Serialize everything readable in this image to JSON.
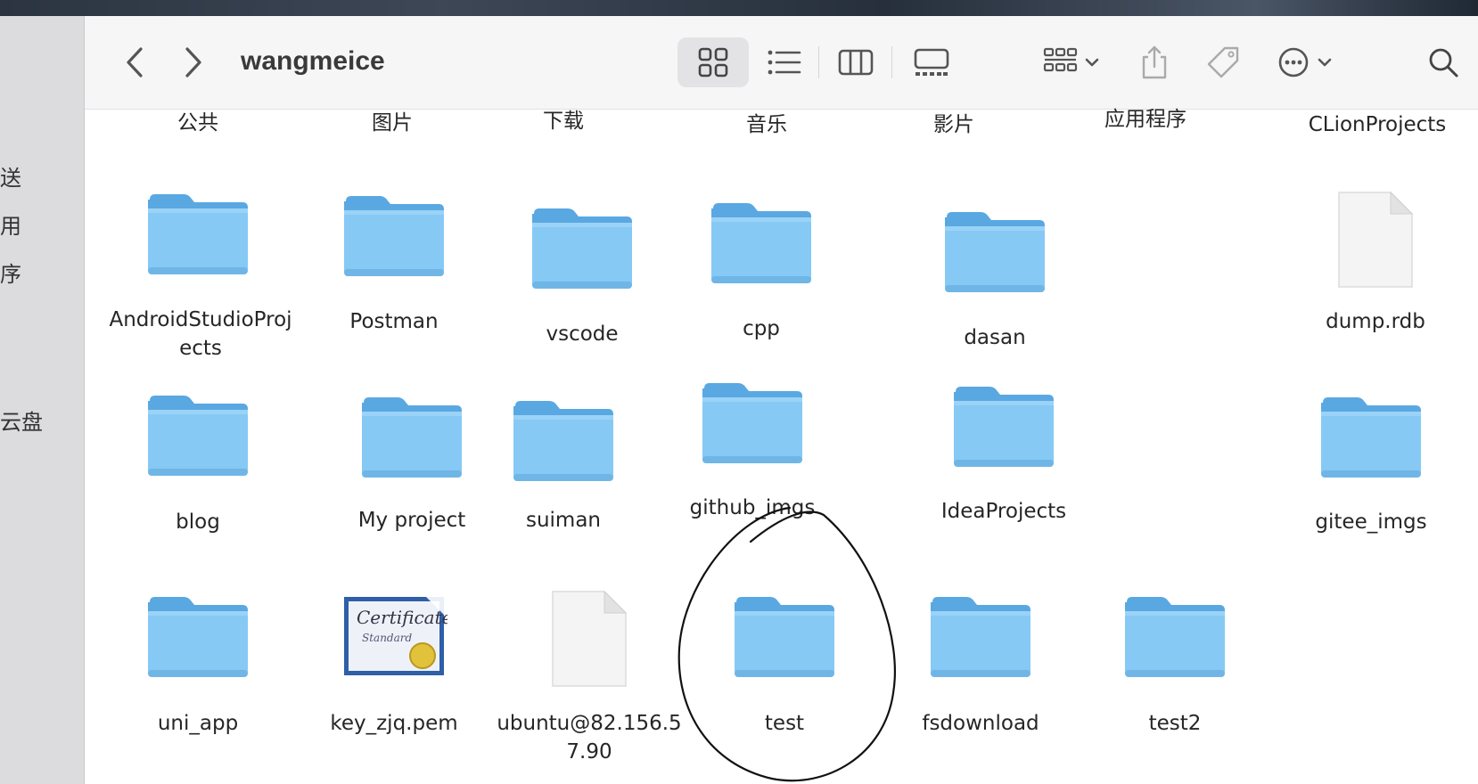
{
  "sidebar": {
    "items": [
      {
        "label": "送"
      },
      {
        "label": "用"
      },
      {
        "label": "序"
      },
      {
        "label": "云盘"
      }
    ]
  },
  "toolbar": {
    "title": "wangmeice",
    "icons": [
      "chevron-left-icon",
      "chevron-right-icon",
      "icon-view-icon",
      "list-view-icon",
      "column-view-icon",
      "gallery-view-icon",
      "group-by-icon",
      "chevron-down-icon",
      "share-icon",
      "tag-icon",
      "more-icon",
      "chevron-down-icon",
      "search-icon"
    ]
  },
  "top_row": [
    "公共",
    "图片",
    "下载",
    "音乐",
    "影片",
    "应用程序",
    "CLionProjects"
  ],
  "row1": [
    {
      "name": "AndroidStudioProj\nects",
      "kind": "folder"
    },
    {
      "name": "Postman",
      "kind": "folder"
    },
    {
      "name": "vscode",
      "kind": "folder"
    },
    {
      "name": "cpp",
      "kind": "folder"
    },
    {
      "name": "dasan",
      "kind": "folder"
    },
    {
      "name": "dump.rdb",
      "kind": "document"
    }
  ],
  "row2": [
    {
      "name": "blog",
      "kind": "folder"
    },
    {
      "name": "My project",
      "kind": "folder"
    },
    {
      "name": "suiman",
      "kind": "folder"
    },
    {
      "name": "github_imgs",
      "kind": "folder"
    },
    {
      "name": "IdeaProjects",
      "kind": "folder"
    },
    {
      "name": "gitee_imgs",
      "kind": "folder"
    }
  ],
  "row3": [
    {
      "name": "uni_app",
      "kind": "folder"
    },
    {
      "name": "key_zjq.pem",
      "kind": "certificate"
    },
    {
      "name": "ubuntu@82.156.5\n7.90",
      "kind": "document"
    },
    {
      "name": "test",
      "kind": "folder"
    },
    {
      "name": "fsdownload",
      "kind": "folder"
    },
    {
      "name": "test2",
      "kind": "folder"
    }
  ],
  "colors": {
    "folder": "#7cc4f2",
    "folder_dark": "#5aa8e2",
    "annotation": "#111111"
  }
}
